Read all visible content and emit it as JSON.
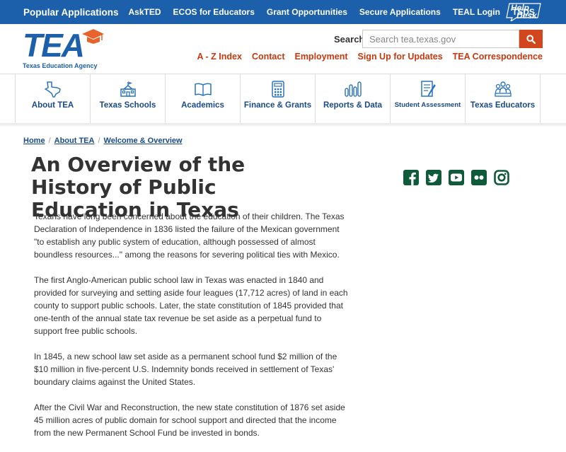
{
  "topbar": {
    "links": [
      "Popular Applications",
      "AskTED",
      "ECOS for Educators",
      "Grant Opportunities",
      "Secure Applications",
      "TEAL Login",
      "TSDS"
    ],
    "help_desk": [
      "Help",
      "Desk"
    ]
  },
  "header": {
    "logo_text": "TEA",
    "logo_subtitle": "Texas Education Agency",
    "search_label": "Search",
    "search_placeholder": "Search tea.texas.gov",
    "links": [
      "A - Z Index",
      "Contact",
      "Employment",
      "Sign Up for Updates",
      "TEA Correspondence"
    ]
  },
  "nav": [
    {
      "label": "About TEA",
      "icon": "texas-map-icon"
    },
    {
      "label": "Texas Schools",
      "icon": "school-building-icon"
    },
    {
      "label": "Academics",
      "icon": "book-icon"
    },
    {
      "label": "Finance & Grants",
      "icon": "calculator-icon"
    },
    {
      "label": "Reports & Data",
      "icon": "bar-chart-icon"
    },
    {
      "label": "Student Assessment",
      "icon": "document-pencil-icon"
    },
    {
      "label": "Texas Educators",
      "icon": "educators-group-icon"
    }
  ],
  "breadcrumb": [
    "Home",
    "About TEA",
    "Welcome & Overview"
  ],
  "page_title": "An Overview of the History of Public Education in Texas",
  "social": [
    "facebook-icon",
    "twitter-icon",
    "youtube-icon",
    "flickr-icon",
    "instagram-icon"
  ],
  "paragraphs": [
    "Texans have long been concerned about the education of their children. The Texas Declaration of Independence in 1836 listed the failure of the Mexican government \"to establish any public system of education, although possessed of almost boundless resources...\" among the reasons for severing political ties with Mexico.",
    "The first Anglo-American public school law in Texas was enacted in 1840 and provided for surveying and setting aside four leagues (17,712 acres) of land in each county to support public schools. Later, the state constitution of 1845 provided that one-tenth of the annual state tax revenue be set aside as a perpetual fund to support free public schools.",
    "In 1845, a new school law set aside as a permanent school fund $2 million of the $10 million in five-percent U.S. Indemnity bonds received in settlement of Texas' boundary claims against the United States.",
    "After the Civil War and Reconstruction, the new state constitution of 1876 set aside 45 million acres of public domain for school support and directed that the income from the new Permanent School Fund be invested in bonds."
  ],
  "colors": {
    "brand_blue": "#1c5faa",
    "accent_orange": "#d2461e",
    "nav_text": "#1a4a86"
  }
}
